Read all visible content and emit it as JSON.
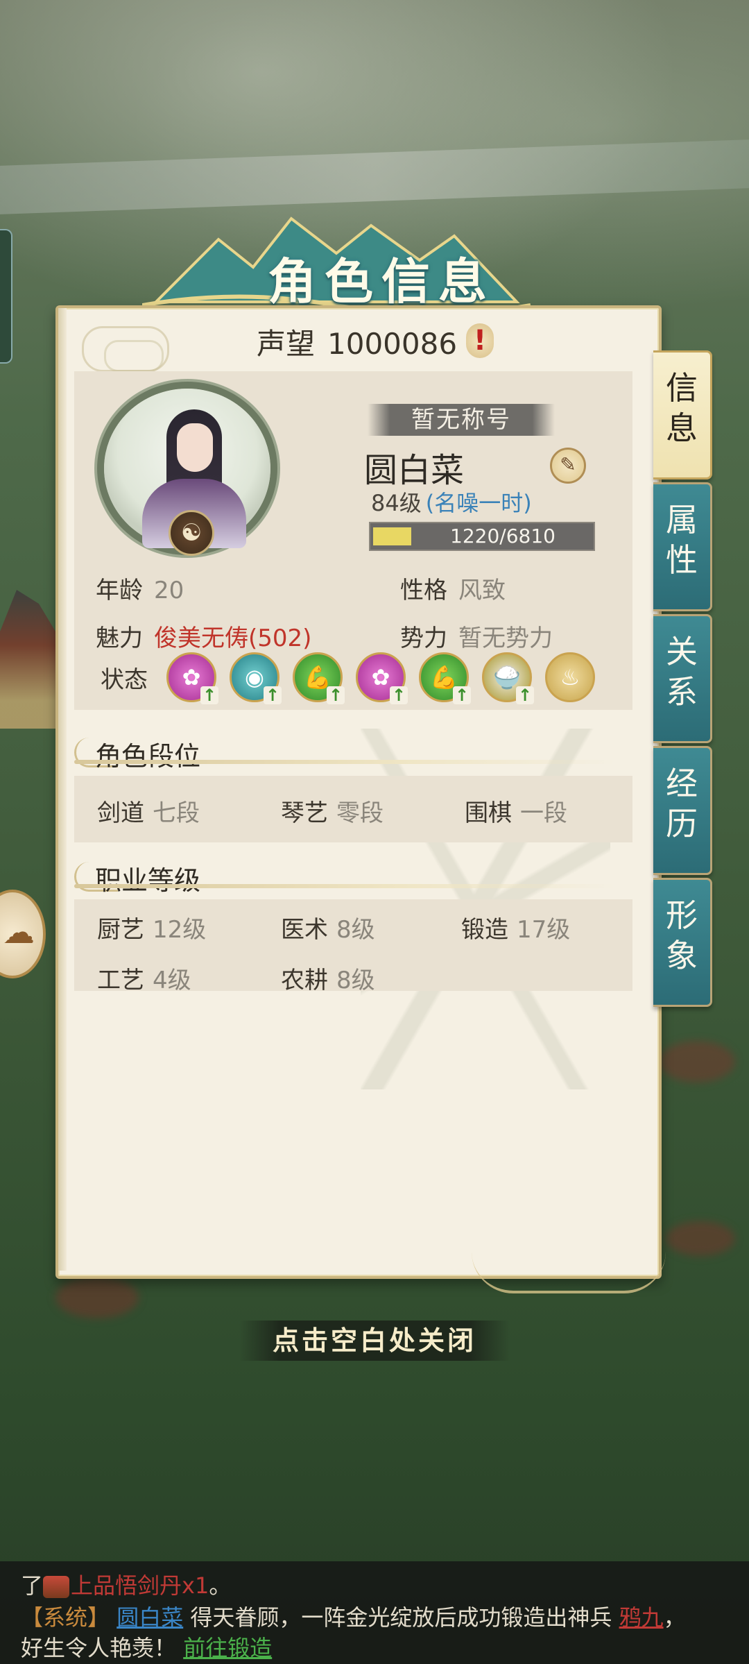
{
  "header": {
    "title": "角色信息"
  },
  "reputation": {
    "label": "声望",
    "value": "1000086",
    "alert_glyph": "!"
  },
  "character": {
    "title_plate": "暂无称号",
    "name": "圆白菜",
    "level": "84级",
    "fame": "(名噪一时)",
    "exp_text": "1220/6810",
    "exp_fraction": 0.179,
    "badge_glyph": "☯"
  },
  "stats": {
    "age": {
      "label": "年龄",
      "value": "20"
    },
    "personality": {
      "label": "性格",
      "value": "风致"
    },
    "charm": {
      "label": "魅力",
      "value": "俊美无俦(502)"
    },
    "faction": {
      "label": "势力",
      "value": "暂无势力"
    },
    "status": {
      "label": "状态"
    }
  },
  "status_icons": [
    {
      "name": "blossom-buff-icon",
      "glyph": "✿",
      "arrow": "↑"
    },
    {
      "name": "eye-buff-icon",
      "glyph": "◉",
      "arrow": "↑"
    },
    {
      "name": "strength-buff-icon",
      "glyph": "💪",
      "arrow": "↑"
    },
    {
      "name": "blossom-buff-icon-2",
      "glyph": "✿",
      "arrow": "↑"
    },
    {
      "name": "strength-buff-icon-2",
      "glyph": "💪",
      "arrow": "↑"
    },
    {
      "name": "food-bowl-buff-icon",
      "glyph": "🍚",
      "arrow": "↑"
    },
    {
      "name": "steam-buff-icon",
      "glyph": "♨",
      "arrow": ""
    }
  ],
  "ranks": {
    "title": "角色段位",
    "items": [
      {
        "label": "剑道",
        "value": "七段"
      },
      {
        "label": "琴艺",
        "value": "零段"
      },
      {
        "label": "围棋",
        "value": "一段"
      }
    ]
  },
  "careers": {
    "title": "职业等级",
    "items": [
      {
        "label": "厨艺",
        "value": "12级"
      },
      {
        "label": "医术",
        "value": "8级"
      },
      {
        "label": "锻造",
        "value": "17级"
      },
      {
        "label": "工艺",
        "value": "4级"
      },
      {
        "label": "农耕",
        "value": "8级"
      }
    ]
  },
  "side_tabs": [
    {
      "label": "信息",
      "active": true
    },
    {
      "label": "属性",
      "active": false
    },
    {
      "label": "关系",
      "active": false
    },
    {
      "label": "经历",
      "active": false
    },
    {
      "label": "形象",
      "active": false
    }
  ],
  "close_hint": "点击空白处关闭",
  "chat": {
    "line1_prefix": "了",
    "line1_item": "上品悟剑丹x1",
    "line1_suffix": "。",
    "line2_sys": "【系统】",
    "line2_user": "圆白菜",
    "line2_text": "得天眷顾，一阵金光绽放后成功锻造出神兵",
    "line2_weapon": "鸦九",
    "line2_end": "，",
    "line3_text": "好生令人艳羡！",
    "line3_link": "前往锻造"
  }
}
